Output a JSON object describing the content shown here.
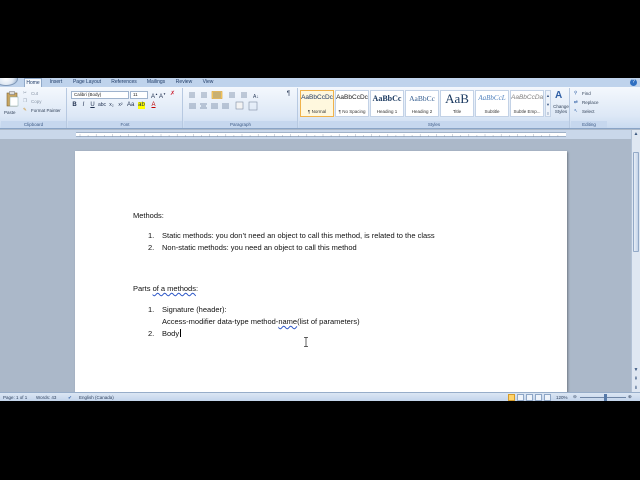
{
  "tabs": [
    "Home",
    "Insert",
    "Page Layout",
    "References",
    "Mailings",
    "Review",
    "View"
  ],
  "clipboard": {
    "paste": "Paste",
    "cut": "Cut",
    "copy": "Copy",
    "format_painter": "Format Painter",
    "label": "Clipboard"
  },
  "font": {
    "family": "Calibri (Body)",
    "size": "11",
    "label": "Font",
    "bold": "B",
    "italic": "I",
    "underline": "U"
  },
  "paragraph": {
    "label": "Paragraph",
    "show_marks": "¶"
  },
  "styles": {
    "label": "Styles",
    "items": [
      {
        "sample": "AaBbCcDc",
        "name": "¶ Normal"
      },
      {
        "sample": "AaBbCcDc",
        "name": "¶ No Spacing"
      },
      {
        "sample": "AaBbCc",
        "name": "Heading 1"
      },
      {
        "sample": "AaBbCc",
        "name": "Heading 2"
      },
      {
        "sample": "AaB",
        "name": "Title"
      },
      {
        "sample": "AaBbCcL",
        "name": "Subtitle"
      },
      {
        "sample": "AaBbCcDa",
        "name": "Subtle Emp..."
      }
    ],
    "change_styles": "Change Styles"
  },
  "editing": {
    "find": "Find",
    "replace": "Replace",
    "select": "Select",
    "label": "Editing"
  },
  "document": {
    "heading1": "Methods:",
    "list1": [
      {
        "num": "1.",
        "text": "Static methods: you don’t need an object to call this method, is related to the class"
      },
      {
        "num": "2.",
        "text": "Non-static methods: you need an object to call this method"
      }
    ],
    "heading2_pre": "Parts ",
    "heading2_underlined": "of a methods",
    "heading2_post": ":",
    "list2": [
      {
        "num": "1.",
        "text": "Signature (header):"
      },
      {
        "num": "2.",
        "text": "Body"
      }
    ],
    "signature_pre": "Access-modifier data-type method-",
    "signature_underlined": "name",
    "signature_post": "(list of parameters)"
  },
  "status": {
    "page": "Page: 1 of 1",
    "words": "Words: 43",
    "language": "English (Canada)",
    "zoom": "120%"
  },
  "colors": {
    "ribbon": "#dde8f6",
    "tab_bar": "#bfd3ec",
    "doc_background": "#abb8c9",
    "spell_underline": "#2a55c6"
  }
}
